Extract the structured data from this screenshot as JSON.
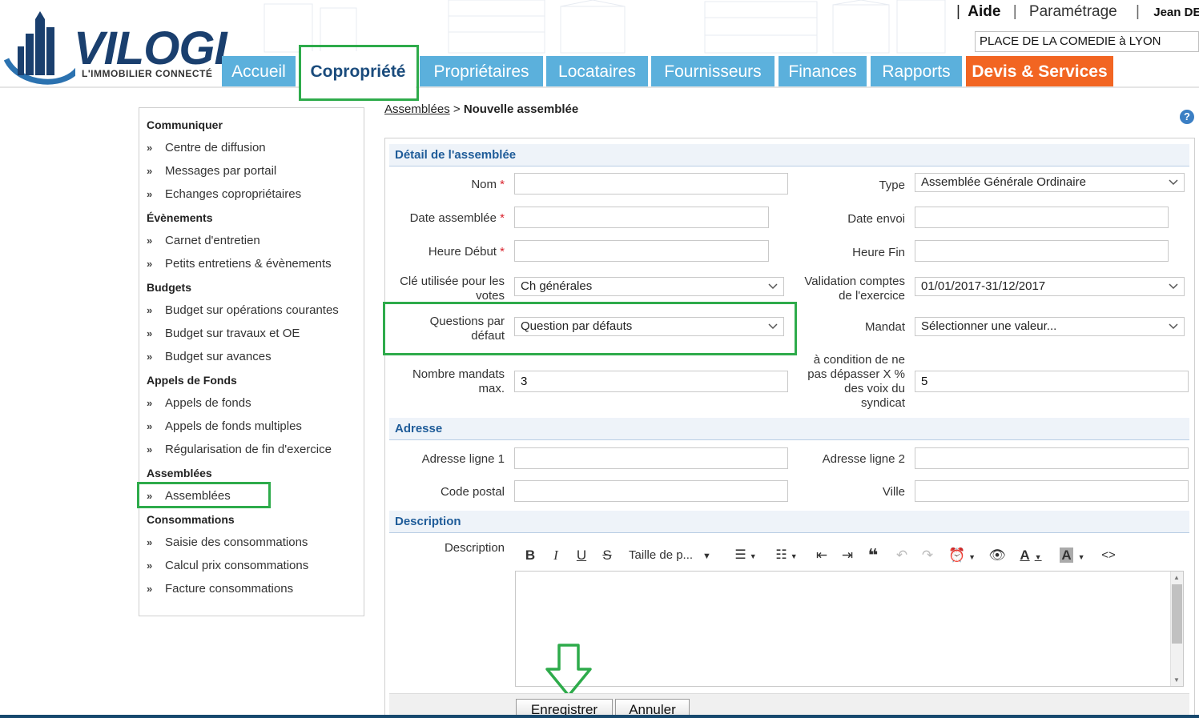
{
  "header": {
    "logo_text": "VILOGI",
    "logo_subtext": "L'IMMOBILIER CONNECTÉ",
    "top_links": {
      "help": "Aide",
      "separator": "|",
      "settings": "Paramétrage",
      "user": "Jean DEM"
    },
    "residence": "PLACE DE LA COMEDIE à LYON",
    "nav_tabs": [
      {
        "label": "Accueil"
      },
      {
        "label": "Copropriété"
      },
      {
        "label": "Propriétaires"
      },
      {
        "label": "Locataires"
      },
      {
        "label": "Fournisseurs"
      },
      {
        "label": "Finances"
      },
      {
        "label": "Rapports"
      },
      {
        "label": "Devis & Services"
      }
    ]
  },
  "sidebar": {
    "sections": [
      {
        "title": "Communiquer",
        "items": [
          "Centre de diffusion",
          "Messages par portail",
          "Echanges copropriétaires"
        ]
      },
      {
        "title": "Évènements",
        "items": [
          "Carnet d'entretien",
          "Petits entretiens & évènements"
        ]
      },
      {
        "title": "Budgets",
        "items": [
          "Budget sur opérations courantes",
          "Budget sur travaux et OE",
          "Budget sur avances"
        ]
      },
      {
        "title": "Appels de Fonds",
        "items": [
          "Appels de fonds",
          "Appels de fonds multiples",
          "Régularisation de fin d'exercice"
        ]
      },
      {
        "title": "Assemblées",
        "items": [
          "Assemblées"
        ]
      },
      {
        "title": "Consommations",
        "items": [
          "Saisie des consommations",
          "Calcul prix consommations",
          "Facture consommations"
        ]
      }
    ],
    "bullet": "»"
  },
  "breadcrumb": {
    "parent": "Assemblées",
    "separator": ">",
    "current": "Nouvelle assemblée"
  },
  "help_label": "?",
  "form": {
    "section_detail": "Détail de l'assemblée",
    "section_address": "Adresse",
    "section_description": "Description",
    "required_mark": "*",
    "fields": {
      "nom": {
        "label": "Nom",
        "value": ""
      },
      "type": {
        "label": "Type",
        "value": "Assemblée Générale Ordinaire"
      },
      "date_assemblee": {
        "label": "Date assemblée",
        "value": ""
      },
      "date_envoi": {
        "label": "Date envoi",
        "value": ""
      },
      "heure_debut": {
        "label": "Heure Début",
        "value": ""
      },
      "heure_fin": {
        "label": "Heure Fin",
        "value": ""
      },
      "cle_votes": {
        "label_line1": "Clé utilisée pour les",
        "label_line2": "votes",
        "value": "Ch générales"
      },
      "validation_comptes": {
        "label_line1": "Validation comptes",
        "label_line2": "de l'exercice",
        "value": "01/01/2017-31/12/2017"
      },
      "questions_defaut": {
        "label_line1": "Questions par",
        "label_line2": "défaut",
        "value": "Question par défauts"
      },
      "mandat": {
        "label": "Mandat",
        "value": "Sélectionner une valeur..."
      },
      "nombre_mandats": {
        "label_line1": "Nombre mandats",
        "label_line2": "max.",
        "value": "3"
      },
      "condition_pct": {
        "label_line1": "à condition de ne",
        "label_line2": "pas dépasser X %",
        "label_line3": "des voix du",
        "label_line4": "syndicat",
        "value": "5"
      },
      "adresse1": {
        "label": "Adresse ligne 1",
        "value": ""
      },
      "adresse2": {
        "label": "Adresse ligne 2",
        "value": ""
      },
      "code_postal": {
        "label": "Code postal",
        "value": ""
      },
      "ville": {
        "label": "Ville",
        "value": ""
      },
      "description": {
        "label": "Description"
      }
    },
    "toolbar": {
      "font_size": "Taille de p..."
    },
    "buttons": {
      "save": "Enregistrer",
      "cancel": "Annuler"
    }
  },
  "colors": {
    "tab_blue": "#5bb0dc",
    "tab_orange": "#f26522",
    "brand_navy": "#1a3f6e",
    "section_blue": "#1f5c99",
    "highlight_green": "#2eab4b",
    "required_red": "#d9232d"
  }
}
